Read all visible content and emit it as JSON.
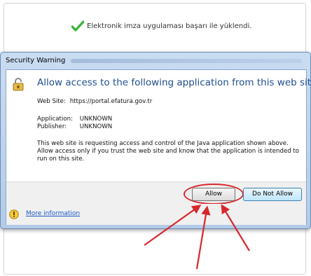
{
  "page": {
    "success_message": "Elektronik imza uygulaması başarı ile yüklendi."
  },
  "dialog": {
    "title": "Security Warning",
    "heading": "Allow access to the following application from this web site?",
    "website_label": "Web Site:",
    "website_value": "https://portal.efatura.gov.tr",
    "application_label": "Application:",
    "application_value": "UNKNOWN",
    "publisher_label": "Publisher:",
    "publisher_value": "UNKNOWN",
    "description": "This web site is requesting access and control of the Java application shown above. Allow access only if you trust the web site and know that the application is intended to run on this site.",
    "allow_label": "Allow",
    "deny_label": "Do Not Allow",
    "more_info_label": "More information"
  },
  "colors": {
    "accent_heading": "#1f4f8f",
    "highlight_annotation": "#d8272c",
    "success_check": "#3cb43c"
  },
  "icons": {
    "success": "check-icon",
    "dialog": "shield-icon",
    "info": "info-icon",
    "annotation": "arrow-icon"
  }
}
